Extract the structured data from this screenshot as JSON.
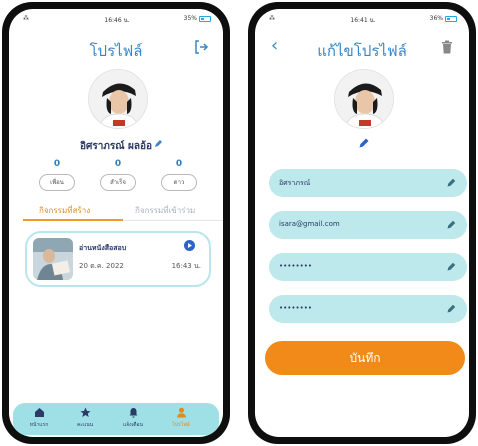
{
  "profile_screen": {
    "status_time": "16:46 น.",
    "battery": "35%",
    "title": "โปรไฟล์",
    "name": "อิศราภรณ์ ผลอ้อ",
    "stats": [
      {
        "count": "0",
        "label": "เพื่อน"
      },
      {
        "count": "0",
        "label": "สำเร็จ"
      },
      {
        "count": "0",
        "label": "ดาว"
      }
    ],
    "tabs": [
      "กิจกรรมที่สร้าง",
      "กิจกรรมที่เข้าร่วม"
    ],
    "activity": {
      "title": "อ่านหนังสือสอบ",
      "date": "20 ต.ค. 2022",
      "time": "16:43 น."
    },
    "nav": [
      "หน้าแรก",
      "คะแนน",
      "แจ้งเตือน",
      "โปรไฟล์"
    ]
  },
  "edit_screen": {
    "status_time": "16:41 น.",
    "battery": "36%",
    "title": "แก้ไขโปรไฟล์",
    "fields": [
      {
        "value": "อิศราภรณ์"
      },
      {
        "value": "isara@gmail.com"
      },
      {
        "value": "••••••••"
      },
      {
        "value": "••••••••"
      }
    ],
    "save_label": "บันทึก"
  },
  "colors": {
    "accent_blue": "#3a86c6",
    "field_bg": "#bde8ec",
    "nav_bg": "#9ee0e6",
    "orange": "#f28a1a"
  },
  "icons": [
    "logout-icon",
    "back-icon",
    "trash-icon",
    "pencil-icon",
    "play-icon",
    "home-icon",
    "star-icon",
    "bell-icon",
    "user-icon"
  ]
}
